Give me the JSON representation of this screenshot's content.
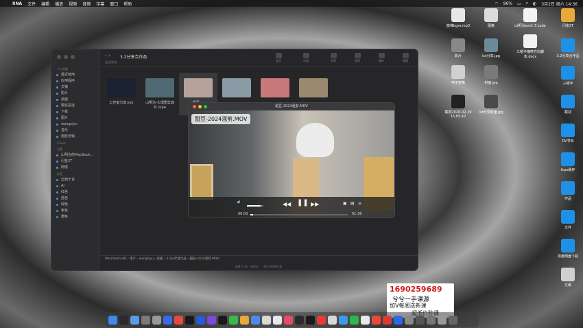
{
  "menubar": {
    "app": "IINA",
    "items": [
      "文件",
      "编辑",
      "播放",
      "视频",
      "音频",
      "字幕",
      "窗口",
      "帮助"
    ],
    "battery": "96%",
    "datetime": "3月2日 周六 14:36"
  },
  "desktop": [
    {
      "label": "旋律bgm.mp3",
      "color": "#e8e8e8"
    },
    {
      "label": "图像",
      "color": "#dcdcdc"
    },
    {
      "label": "山明治evv1.7.cube",
      "color": "#f2f2f2"
    },
    {
      "label": "闪金2T",
      "color": "#e8a83a"
    },
    {
      "label": "影片",
      "color": "#888"
    },
    {
      "label": "lut分享.jpg",
      "color": "#6a8a9a"
    },
    {
      "label": "三顿半咖啡方向脚本.docx",
      "color": "#f2f2f2"
    },
    {
      "label": "3.2分享合作品",
      "color": "#1e90e8"
    },
    {
      "label": "电子表格",
      "color": "#d0d0d0"
    },
    {
      "label": "封面.jpg",
      "color": "#7a7a7a"
    },
    {
      "label": "三顿半",
      "color": "#1e90e8"
    },
    {
      "label": "截屏2026-02-29 15.05.42",
      "color": "#222"
    },
    {
      "label": "lut分享封面.jpg",
      "color": "#4a4a4a"
    },
    {
      "label": "截材",
      "color": "#1e90e8"
    },
    {
      "label": "DV节目",
      "color": "#1e90e8"
    },
    {
      "label": "fcpx缓存",
      "color": "#1e90e8"
    },
    {
      "label": "作品",
      "color": "#1e90e8"
    },
    {
      "label": "文件",
      "color": "#1e90e8"
    },
    {
      "label": "百度网盘下载",
      "color": "#1e90e8"
    },
    {
      "label": "文稿",
      "color": "#d0d0d0"
    }
  ],
  "finder": {
    "title": "3.2分享合作品",
    "nav": "返回/前进",
    "toolbar": [
      "显示",
      "分组",
      "共享",
      "标签",
      "操作",
      "搜索"
    ],
    "sidebar": {
      "favorites_header": "个人收藏",
      "favorites": [
        "最近使用",
        "应用程序",
        "文稿",
        "影片",
        "桌面",
        "隔空投送",
        "下载",
        "图片",
        "wangziyu",
        "音乐",
        "电影剪辑"
      ],
      "icloud_header": "iCloud",
      "locations_header": "位置",
      "locations": [
        "山明治的MacBook…",
        "闪金2T",
        "网络"
      ],
      "tags_header": "标签",
      "tags": [
        "剪辑干货",
        "AI",
        "红色",
        "蓝色",
        "绿色",
        "紫色",
        "橙色"
      ]
    },
    "files": [
      {
        "name": "工作室分享.key",
        "thumb": "#1a2230"
      },
      {
        "name": "山明治-大理质剪成片.mp4",
        "thumb": "#4f6a72"
      },
      {
        "name": "甜豆-...",
        "thumb": "#b5a29a"
      },
      {
        "name": "",
        "thumb": "#8a9ba6"
      },
      {
        "name": "",
        "thumb": "#c87a7a"
      },
      {
        "name": "",
        "thumb": "#9a8a70"
      }
    ],
    "path": [
      "Macintosh HD",
      "用户",
      "wangziyu",
      "桌面",
      "3.2分享合作品",
      "甜豆-2024混剪.MOV"
    ],
    "status": "选择了1项（共6项），365.69GB可用"
  },
  "player": {
    "title": "甜豆-2024混剪.MOV",
    "overlay": "甜豆-2024混剪.MOV",
    "elapsed": "00:03",
    "remaining": "01:36",
    "progress": 0.03,
    "volume": 0.85
  },
  "promo": {
    "number": "1690259689",
    "line2": "兮兮一手课源",
    "line3": "加V每周送新课",
    "line4": "超低价秒课"
  }
}
